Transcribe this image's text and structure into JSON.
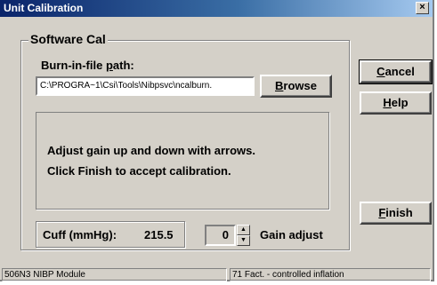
{
  "window": {
    "title": "Unit Calibration",
    "close_glyph": "×"
  },
  "group": {
    "title": "Software Cal"
  },
  "path": {
    "label_pre": "Burn-in-file ",
    "label_key": "p",
    "label_post": "ath:",
    "value": "C:\\PROGRA~1\\Csi\\Tools\\Nibpsvc\\ncalburn."
  },
  "buttons": {
    "browse": {
      "key": "B",
      "rest": "rowse"
    },
    "cancel": {
      "key": "C",
      "rest": "ancel"
    },
    "help": {
      "key": "H",
      "rest": "elp"
    },
    "finish": {
      "key": "F",
      "rest": "inish"
    }
  },
  "message": {
    "line1": "Adjust gain up and down with arrows.",
    "line2": "Click Finish to accept calibration."
  },
  "cuff": {
    "label": "Cuff (mmHg):",
    "value": "215.5"
  },
  "gain": {
    "value": "0",
    "label": "Gain adjust",
    "up_glyph": "▲",
    "down_glyph": "▼"
  },
  "status": {
    "panel1": "506N3 NIBP Module",
    "panel2": "71 Fact. - controlled inflation"
  }
}
